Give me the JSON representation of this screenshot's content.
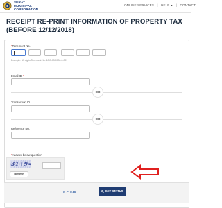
{
  "header": {
    "org_lines": [
      "SURAT",
      "MUNICIPAL",
      "CORPORATION"
    ],
    "nav": {
      "online_services": "ONLINE SERVICES",
      "sep1": "|",
      "help": "HELP",
      "help_caret": "▼",
      "sep2": "|",
      "contact": "CONTACT"
    }
  },
  "page_title": "RECEIPT RE-PRINT INFORMATION OF PROPERTY TAX (BEFORE 12/12/2018)",
  "form": {
    "tenement": {
      "label": "Tenement No.",
      "required_mark": "*",
      "hint": "Example: 13 digits Tenement No. 10-B-03-0000-0-001"
    },
    "email": {
      "label": "Email ID",
      "required_mark": "*"
    },
    "or_text": "OR",
    "transaction": {
      "label": "Transaction ID"
    },
    "reference": {
      "label": "Reference No."
    },
    "captcha": {
      "label": "Answer below question",
      "required_mark": "*",
      "question": "31+9=?",
      "refresh_label": "Refresh"
    }
  },
  "footer": {
    "clear_icon": "↻",
    "clear_label": "CLEAR",
    "get_status_icon": "search-icon",
    "get_status_label": "GET STATUS"
  },
  "colors": {
    "brand": "#1a3a78",
    "primary_button": "#1f3c72",
    "annotation_arrow": "#e0201f"
  }
}
